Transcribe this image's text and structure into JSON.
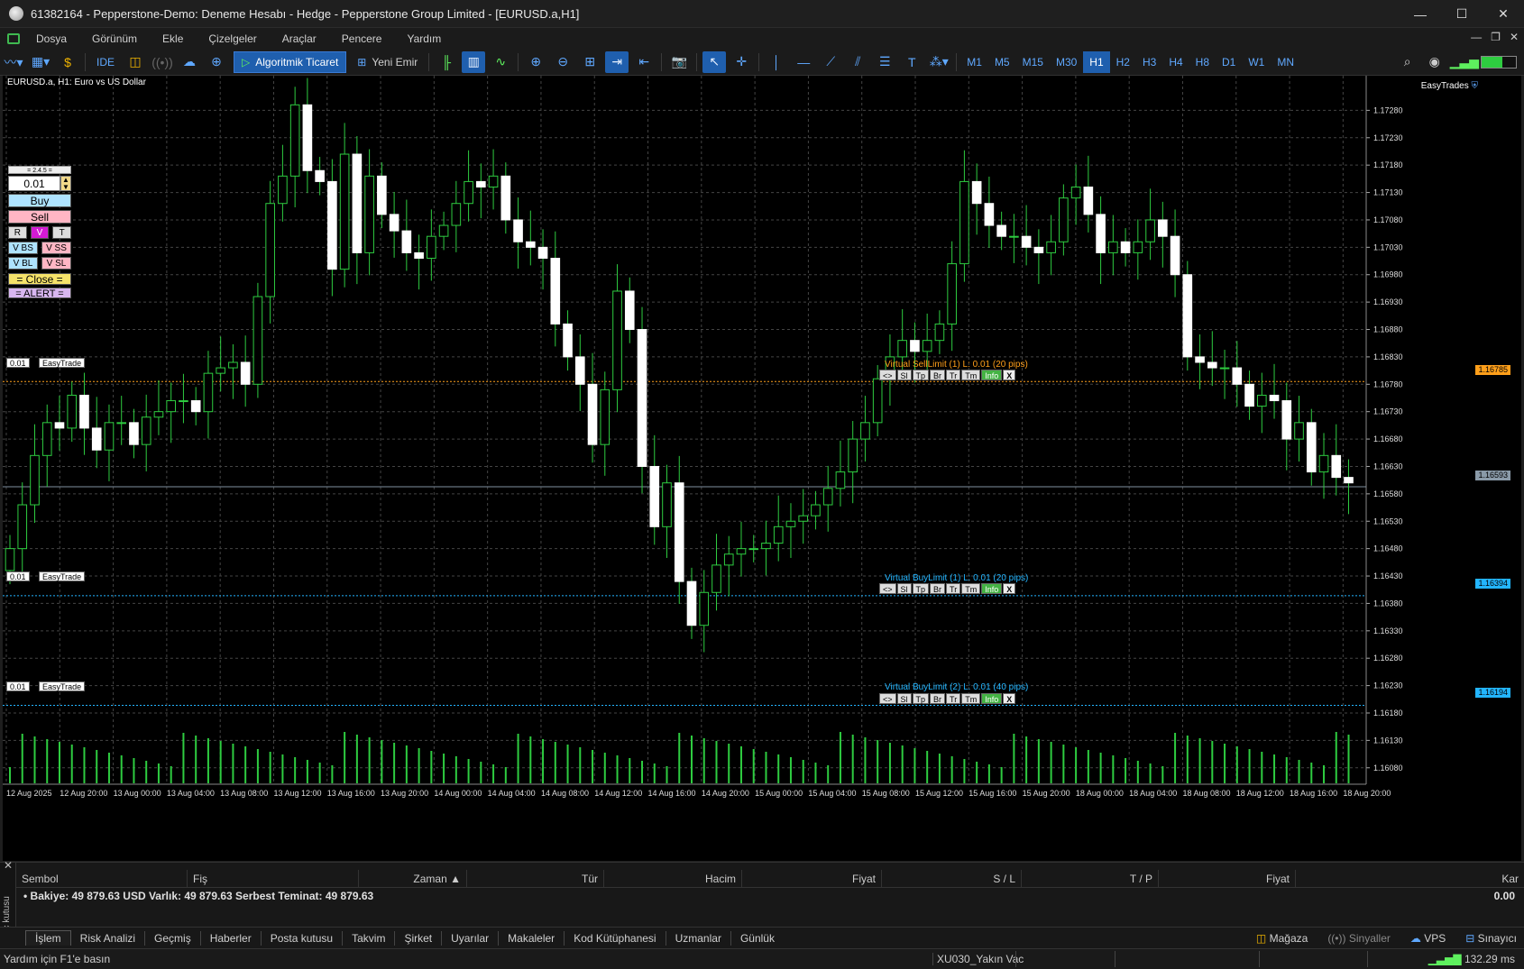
{
  "window": {
    "title": "61382164 - Pepperstone-Demo: Deneme Hesabı - Hedge - Pepperstone Group Limited - [EURUSD.a,H1]"
  },
  "menu": [
    "Dosya",
    "Görünüm",
    "Ekle",
    "Çizelgeler",
    "Araçlar",
    "Pencere",
    "Yardım"
  ],
  "toolbar": {
    "ide": "IDE",
    "algo": "Algoritmik Ticaret",
    "new_order": "Yeni Emir",
    "timeframes": [
      "M1",
      "M5",
      "M15",
      "M30",
      "H1",
      "H2",
      "H3",
      "H4",
      "H8",
      "D1",
      "W1",
      "MN"
    ],
    "active_tf": "H1"
  },
  "chart": {
    "symbol": "EURUSD.a, H1:  Euro vs US Dollar",
    "easytrades": "EasyTrades"
  },
  "panel": {
    "header": "= 2.4.5 =",
    "lot": "0.01",
    "buy": "Buy",
    "sell": "Sell",
    "r": "R",
    "v": "V",
    "t": "T",
    "vbs": "V BS",
    "vss": "V SS",
    "vbl": "V BL",
    "vsl": "V SL",
    "close": "= Close =",
    "alert": "= ALERT ="
  },
  "orders": [
    {
      "tag_lot": "0.01",
      "tag_name": "EasyTrade",
      "label": "Virtual SellLimit (1) L: 0.01 (20 pips)",
      "price": "1.16785",
      "color": "#ff9f1a"
    },
    {
      "tag_lot": "0.01",
      "tag_name": "EasyTrade",
      "label": "Virtual BuyLimit (1) L: 0.01 (20 pips)",
      "price": "1.16394",
      "color": "#23b5ff"
    },
    {
      "tag_lot": "0.01",
      "tag_name": "EasyTrade",
      "label": "Virtual BuyLimit (2) L: 0.01 (40 pips)",
      "price": "1.16194",
      "color": "#23b5ff"
    }
  ],
  "order_buttons": [
    "<>",
    "Sl",
    "Tp",
    "Br",
    "Tr",
    "Tm",
    "Info",
    "X"
  ],
  "current_price": "1.16593",
  "chart_data": {
    "type": "candlestick",
    "title": "EURUSD.a, H1:  Euro vs US Dollar",
    "y_ticks": [
      "1.17280",
      "1.17230",
      "1.17180",
      "1.17130",
      "1.17080",
      "1.17030",
      "1.16980",
      "1.16930",
      "1.16880",
      "1.16830",
      "1.16780",
      "1.16730",
      "1.16680",
      "1.16630",
      "1.16580",
      "1.16530",
      "1.16480",
      "1.16430",
      "1.16380",
      "1.16330",
      "1.16280",
      "1.16230",
      "1.16180",
      "1.16130",
      "1.16080"
    ],
    "ylim": [
      1.1605,
      1.1733
    ],
    "x_ticks": [
      "12 Aug 2025",
      "12 Aug 20:00",
      "13 Aug 00:00",
      "13 Aug 04:00",
      "13 Aug 08:00",
      "13 Aug 12:00",
      "13 Aug 16:00",
      "13 Aug 20:00",
      "14 Aug 00:00",
      "14 Aug 04:00",
      "14 Aug 08:00",
      "14 Aug 12:00",
      "14 Aug 16:00",
      "14 Aug 20:00",
      "15 Aug 00:00",
      "15 Aug 04:00",
      "15 Aug 08:00",
      "15 Aug 12:00",
      "15 Aug 16:00",
      "15 Aug 20:00",
      "18 Aug 00:00",
      "18 Aug 04:00",
      "18 Aug 08:00",
      "18 Aug 12:00",
      "18 Aug 16:00",
      "18 Aug 20:00"
    ],
    "closes": [
      1.1648,
      1.1656,
      1.1665,
      1.1671,
      1.167,
      1.1676,
      1.167,
      1.1666,
      1.1671,
      1.1671,
      1.1667,
      1.1672,
      1.1673,
      1.1675,
      1.1675,
      1.1673,
      1.168,
      1.1681,
      1.1682,
      1.1678,
      1.1694,
      1.1711,
      1.1716,
      1.1729,
      1.1717,
      1.1715,
      1.1699,
      1.172,
      1.1702,
      1.1716,
      1.1709,
      1.1706,
      1.1702,
      1.1701,
      1.1705,
      1.1707,
      1.1711,
      1.1715,
      1.1714,
      1.1716,
      1.1708,
      1.1704,
      1.1703,
      1.1701,
      1.1689,
      1.1683,
      1.1678,
      1.1667,
      1.1677,
      1.1695,
      1.1688,
      1.1663,
      1.1652,
      1.166,
      1.1642,
      1.1634,
      1.164,
      1.1645,
      1.1647,
      1.1648,
      1.1648,
      1.1649,
      1.1652,
      1.1653,
      1.1654,
      1.1656,
      1.1659,
      1.1662,
      1.1668,
      1.1671,
      1.1679,
      1.1683,
      1.1686,
      1.1684,
      1.1686,
      1.1689,
      1.17,
      1.1715,
      1.1711,
      1.1707,
      1.1705,
      1.1705,
      1.1703,
      1.1702,
      1.1704,
      1.1712,
      1.1714,
      1.1709,
      1.1702,
      1.1704,
      1.1702,
      1.1704,
      1.1708,
      1.1705,
      1.1698,
      1.1683,
      1.1682,
      1.1681,
      1.1681,
      1.1678,
      1.1674,
      1.1676,
      1.1675,
      1.1668,
      1.1671,
      1.1662,
      1.1665,
      1.1661,
      1.166
    ]
  },
  "toolbox": {
    "vertical": "Araç kutusu",
    "columns": [
      "Sembol",
      "Fiş",
      "Zaman",
      "Tür",
      "Hacim",
      "Fiyat",
      "S / L",
      "T / P",
      "Fiyat",
      "Kar"
    ],
    "balance": "Bakiye: 49 879.63 USD  Varlık: 49 879.63  Serbest Teminat: 49 879.63",
    "profit": "0.00"
  },
  "tabs": [
    "İşlem",
    "Risk Analizi",
    "Geçmiş",
    "Haberler",
    "Posta kutusu",
    "Takvim",
    "Şirket",
    "Uyarılar",
    "Makaleler",
    "Kod Kütüphanesi",
    "Uzmanlar",
    "Günlük"
  ],
  "tabs_right": [
    "Mağaza",
    "Sinyaller",
    "VPS",
    "Sınayıcı"
  ],
  "status": {
    "help": "Yardım için F1'e basın",
    "profile": "XU030_Yakın Vac",
    "ping": "132.29 ms"
  }
}
